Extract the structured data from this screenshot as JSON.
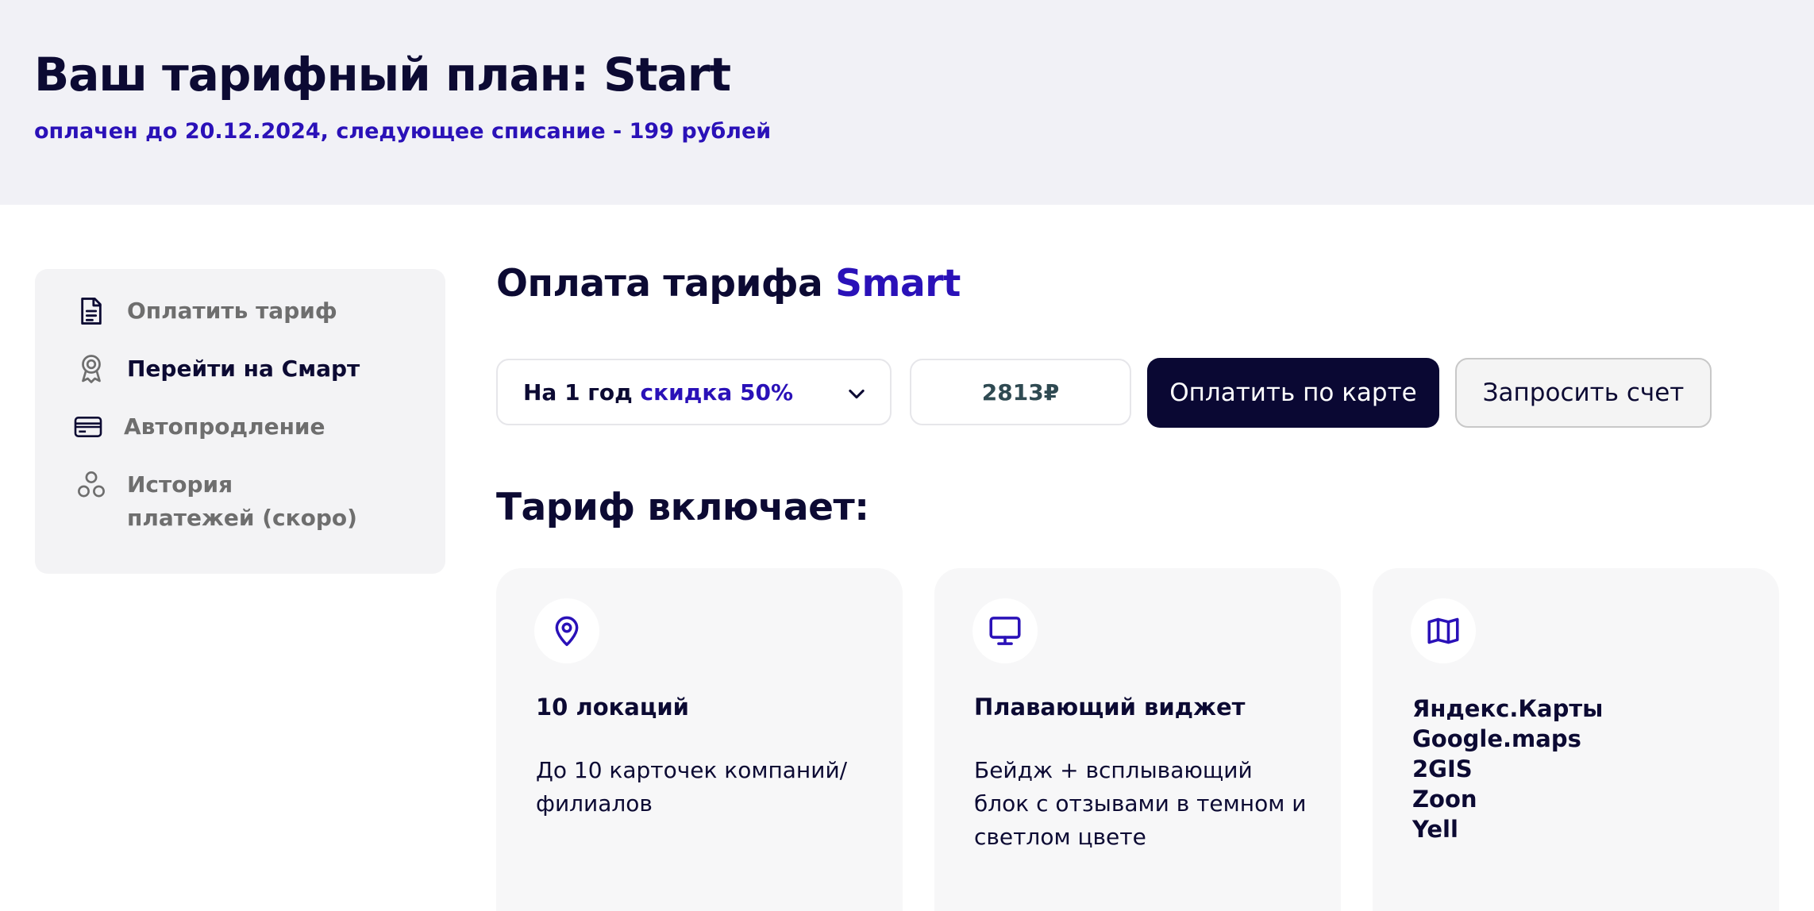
{
  "header": {
    "title": "Ваш тарифный план: Start",
    "subtitle": "оплачен до 20.12.2024, следующее списание - 199 рублей"
  },
  "sidebar": {
    "items": [
      {
        "label": "Оплатить тариф",
        "icon": "document-icon",
        "active": false
      },
      {
        "label": "Перейти на Смарт",
        "icon": "award-icon",
        "active": true
      },
      {
        "label": "Автопродление",
        "icon": "credit-card-icon",
        "active": false
      },
      {
        "label": "История платежей (скоро)",
        "icon": "circles-icon",
        "active": false
      }
    ]
  },
  "payment": {
    "title_prefix": "Оплата тарифа",
    "title_plan": "Smart",
    "period_label": "На 1 год",
    "period_discount": "скидка 50%",
    "price": "2813₽",
    "pay_card_label": "Оплатить по карте",
    "invoice_label": "Запросить счет"
  },
  "includes": {
    "title": "Тариф включает:",
    "cards": [
      {
        "icon": "map-pin-icon",
        "title": "10 локаций",
        "description": "До 10 карточек компаний/ филиалов"
      },
      {
        "icon": "monitor-icon",
        "title": "Плавающий виджет",
        "description": "Бейдж + всплывающий блок с отзывами в темном и светлом цвете"
      },
      {
        "icon": "map-icon",
        "items": [
          "Яндекс.Карты",
          "Google.maps",
          "2GIS",
          "Zoon",
          "Yell"
        ]
      }
    ]
  },
  "colors": {
    "accent": "#2a11b8",
    "primary_dark": "#0a0833",
    "header_bg": "#f1f1f6"
  }
}
